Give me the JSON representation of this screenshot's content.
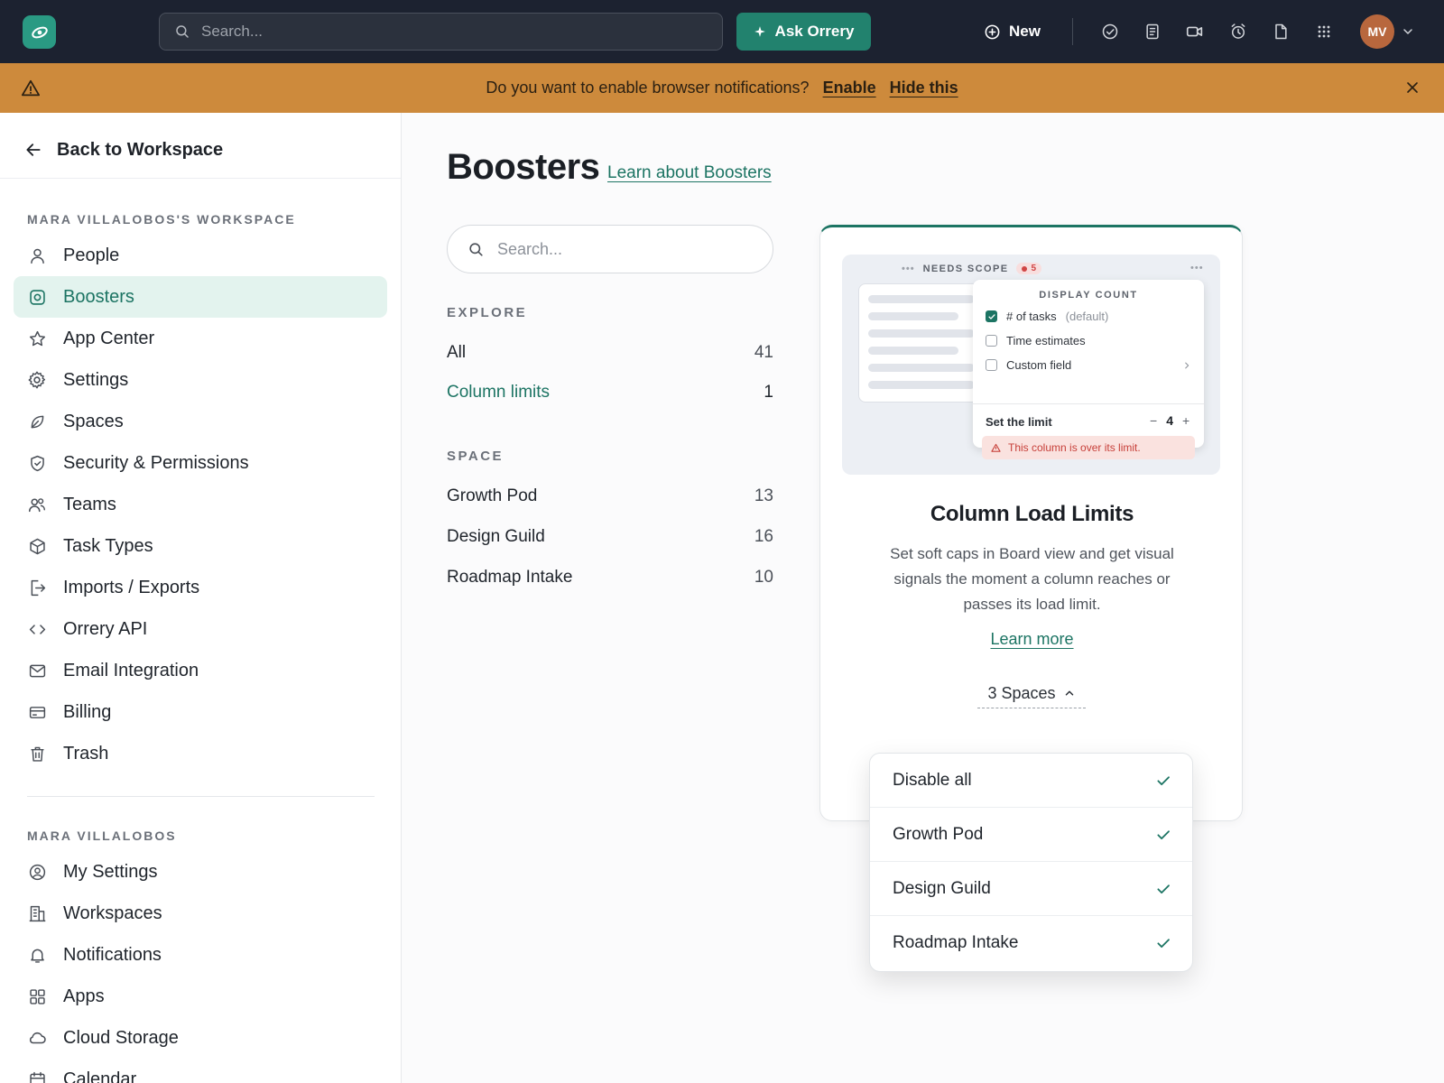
{
  "topbar": {
    "search_placeholder": "Search...",
    "ask_label": "Ask Orrery",
    "new_label": "New",
    "avatar_initials": "MV"
  },
  "banner": {
    "message": "Do you want to enable browser notifications?",
    "enable_label": "Enable",
    "hide_label": "Hide this"
  },
  "sidebar": {
    "back_label": "Back to Workspace",
    "workspace_heading": "Mara Villalobos's Workspace",
    "workspace_items": [
      {
        "label": "People",
        "icon": "person-icon"
      },
      {
        "label": "Boosters",
        "icon": "booster-icon"
      },
      {
        "label": "App Center",
        "icon": "star-icon"
      },
      {
        "label": "Settings",
        "icon": "gear-icon"
      },
      {
        "label": "Spaces",
        "icon": "leaf-icon"
      },
      {
        "label": "Security & Permissions",
        "icon": "shield-icon"
      },
      {
        "label": "Teams",
        "icon": "team-icon"
      },
      {
        "label": "Task Types",
        "icon": "box-icon"
      },
      {
        "label": "Imports / Exports",
        "icon": "export-icon"
      },
      {
        "label": "Orrery API",
        "icon": "code-icon"
      },
      {
        "label": "Email Integration",
        "icon": "mail-icon"
      },
      {
        "label": "Billing",
        "icon": "card-icon"
      },
      {
        "label": "Trash",
        "icon": "trash-icon"
      }
    ],
    "personal_heading": "Mara Villalobos",
    "personal_items": [
      {
        "label": "My Settings",
        "icon": "user-circle-icon"
      },
      {
        "label": "Workspaces",
        "icon": "building-icon"
      },
      {
        "label": "Notifications",
        "icon": "bell-icon"
      },
      {
        "label": "Apps",
        "icon": "apps-icon"
      },
      {
        "label": "Cloud Storage",
        "icon": "cloud-icon"
      },
      {
        "label": "Calendar",
        "icon": "calendar-icon"
      }
    ]
  },
  "main": {
    "title": "Boosters",
    "learn_link": "Learn about Boosters",
    "search_placeholder": "Search...",
    "explore_heading": "EXPLORE",
    "explore_items": [
      {
        "label": "All",
        "count": "41"
      },
      {
        "label": "Column limits",
        "count": "1"
      }
    ],
    "space_heading": "SPACE",
    "space_items": [
      {
        "label": "Growth Pod",
        "count": "13"
      },
      {
        "label": "Design Guild",
        "count": "16"
      },
      {
        "label": "Roadmap Intake",
        "count": "10"
      }
    ]
  },
  "card": {
    "illustration": {
      "column_name": "NEEDS SCOPE",
      "badge_count": "5",
      "popover_heading": "DISPLAY COUNT",
      "options": [
        {
          "label": "# of tasks",
          "note": "(default)",
          "checked": true
        },
        {
          "label": "Time estimates",
          "note": "",
          "checked": false
        },
        {
          "label": "Custom field",
          "note": "",
          "checked": false
        }
      ],
      "limit_label": "Set the limit",
      "limit_value": "4",
      "warning": "This column is over its limit."
    },
    "title": "Column Load Limits",
    "description": "Set soft caps in Board view and get visual signals the moment a column reaches or passes its load limit.",
    "learn_more": "Learn more",
    "spaces_toggle": "3 Spaces"
  },
  "dropdown": {
    "items": [
      {
        "label": "Disable all",
        "checked": true
      },
      {
        "label": "Growth Pod",
        "checked": true
      },
      {
        "label": "Design Guild",
        "checked": true
      },
      {
        "label": "Roadmap Intake",
        "checked": true
      }
    ]
  },
  "colors": {
    "accent": "#1c7463",
    "topbar_bg": "#1c2230",
    "banner_bg": "#cd8a3c",
    "active_item_bg": "#e3f3ee",
    "warning_red": "#d04545"
  }
}
